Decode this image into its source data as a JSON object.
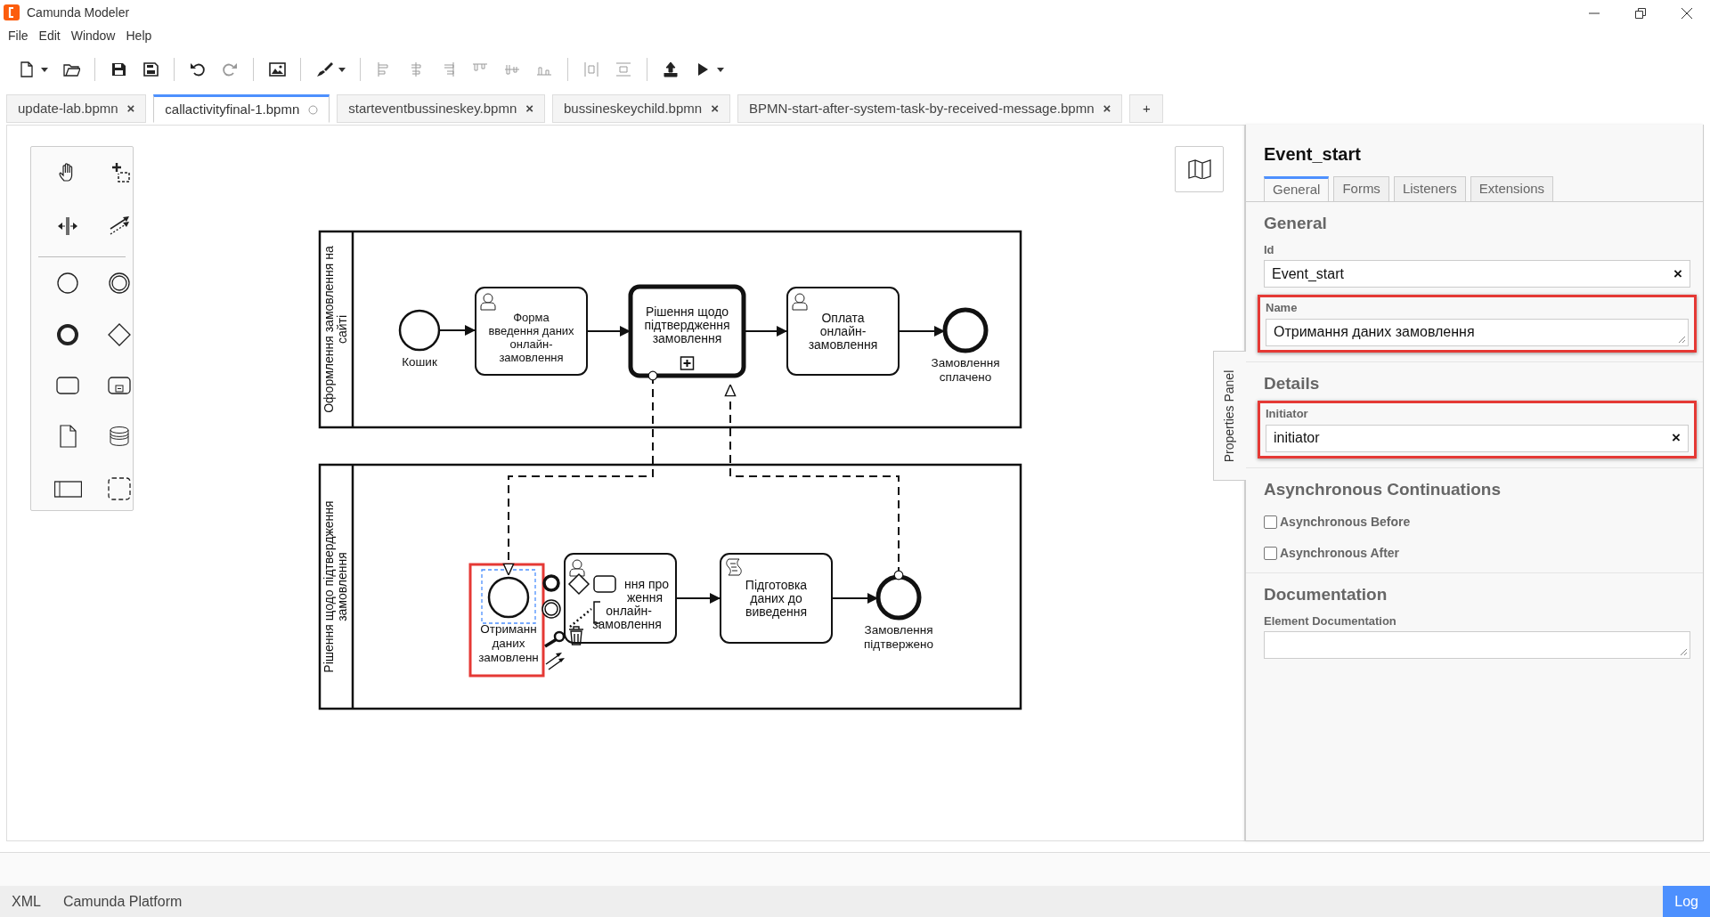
{
  "window": {
    "title": "Camunda Modeler"
  },
  "menu": [
    "File",
    "Edit",
    "Window",
    "Help"
  ],
  "tabs": [
    {
      "label": "update-lab.bpmn",
      "selected": false,
      "unsaved": false,
      "close": "×"
    },
    {
      "label": "callactivityfinal-1.bpmn",
      "selected": true,
      "unsaved": true
    },
    {
      "label": "starteventbussineskey.bpmn",
      "selected": false,
      "unsaved": false,
      "close": "×"
    },
    {
      "label": "bussineskeychild.bpmn",
      "selected": false,
      "unsaved": false,
      "close": "×"
    },
    {
      "label": "BPMN-start-after-system-task-by-received-message.bpmn",
      "selected": false,
      "unsaved": false,
      "close": "×"
    }
  ],
  "new_tab": "+",
  "diagram": {
    "lanes": [
      {
        "label": [
          "Оформлення замовлення на",
          "сайті"
        ],
        "elements": [
          {
            "kind": "start_event",
            "label": [
              "Кошик"
            ],
            "selected": false,
            "highlighted": false
          },
          {
            "kind": "user_task",
            "label": [
              "Форма",
              "введення даних",
              "онлайн-",
              "замовлення"
            ],
            "selected": false,
            "highlighted": false
          },
          {
            "kind": "subprocess",
            "label": [
              "Рішення щодо",
              "підтвердження",
              "замовлення"
            ],
            "selected": false,
            "highlighted": false
          },
          {
            "kind": "user_task",
            "label": [
              "Оплата",
              "онлайн-",
              "замовлення"
            ],
            "selected": false,
            "highlighted": false
          },
          {
            "kind": "end_event",
            "label": [
              "Замовлення",
              "сплачено"
            ],
            "selected": false,
            "highlighted": false
          }
        ]
      },
      {
        "label": [
          "Рішення щодо підтвердження",
          "замовлення"
        ],
        "elements": [
          {
            "kind": "start_event",
            "label": [
              "Отриманн",
              "даних",
              "замовленн"
            ],
            "selected": true,
            "highlighted": true
          },
          {
            "kind": "user_task",
            "label": [
              "ння про",
              "ження",
              "онлайн-",
              "замовлення"
            ],
            "selected": false,
            "highlighted": false
          },
          {
            "kind": "script_task",
            "label": [
              "Підготовка",
              "даних до",
              "виведення"
            ],
            "selected": false,
            "highlighted": false
          },
          {
            "kind": "end_event",
            "label": [
              "Замовлення",
              "підтвержено"
            ],
            "selected": false,
            "highlighted": false
          }
        ]
      }
    ]
  },
  "properties": {
    "title": "Event_start",
    "side_tab": "Properties Panel",
    "tabs": [
      {
        "label": "General",
        "selected": true
      },
      {
        "label": "Forms",
        "selected": false
      },
      {
        "label": "Listeners",
        "selected": false
      },
      {
        "label": "Extensions",
        "selected": false
      }
    ],
    "sections": [
      {
        "heading": "General",
        "fields": [
          {
            "kind": "text",
            "label": "Id",
            "value": "Event_start",
            "clear": "×",
            "highlighted": false
          },
          {
            "kind": "textarea",
            "label": "Name",
            "value": "Отримання даних замовлення",
            "highlighted": true
          }
        ]
      },
      {
        "heading": "Details",
        "fields": [
          {
            "kind": "text",
            "label": "Initiator",
            "value": "initiator",
            "clear": "×",
            "highlighted": true
          }
        ]
      },
      {
        "heading": "Asynchronous Continuations",
        "fields": [
          {
            "kind": "checkbox",
            "label": "Asynchronous Before",
            "checked": false
          },
          {
            "kind": "checkbox",
            "label": "Asynchronous After",
            "checked": false
          }
        ]
      },
      {
        "heading": "Documentation",
        "fields": [
          {
            "kind": "textarea",
            "label": "Element Documentation",
            "highlighted": false
          }
        ]
      }
    ]
  },
  "status_bar": {
    "items": [
      "XML",
      "Camunda Platform"
    ],
    "log": "Log"
  }
}
